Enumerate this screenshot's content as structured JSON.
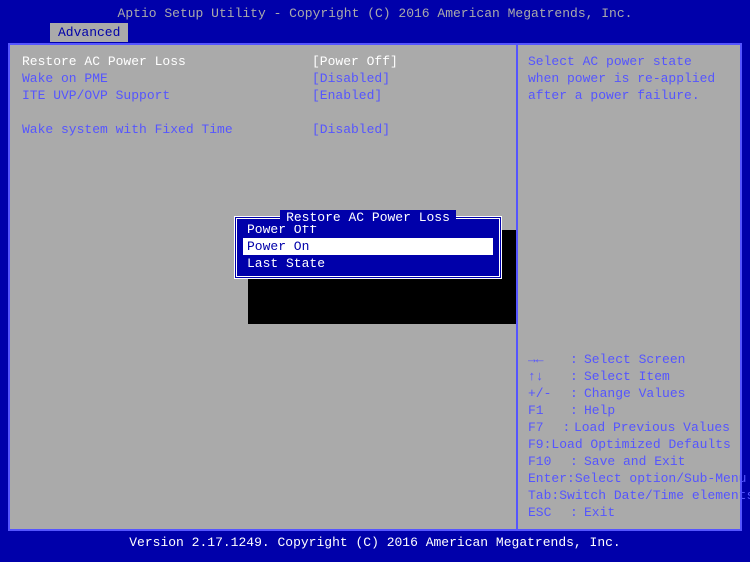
{
  "title": "Aptio Setup Utility - Copyright (C) 2016 American Megatrends, Inc.",
  "tab": "Advanced",
  "settings": [
    {
      "label": "Restore AC Power Loss",
      "value": "[Power Off]",
      "selected": true
    },
    {
      "label": "Wake on PME",
      "value": "[Disabled]",
      "selected": false
    },
    {
      "label": "ITE UVP/OVP Support",
      "value": "[Enabled]",
      "selected": false
    },
    {
      "label": "",
      "value": "",
      "blank": true
    },
    {
      "label": "Wake system with Fixed Time",
      "value": "[Disabled]",
      "selected": false
    }
  ],
  "help": "Select AC power state when power is re-applied after a power failure.",
  "keys": [
    {
      "k": "→←",
      "d": "Select Screen"
    },
    {
      "k": "↑↓",
      "d": "Select Item"
    },
    {
      "k": "+/-",
      "d": "Change Values"
    },
    {
      "k": "F1",
      "d": "Help"
    },
    {
      "k": "F7",
      "d": "Load Previous Values"
    },
    {
      "k": "F9",
      "d": "Load Optimized Defaults"
    },
    {
      "k": "F10",
      "d": "Save and Exit"
    },
    {
      "k": "Enter:",
      "d": "Select option/Sub-Menu",
      "nosep": true
    },
    {
      "k": "Tab",
      "d": "Switch Date/Time elements"
    },
    {
      "k": "ESC",
      "d": "Exit"
    }
  ],
  "popup": {
    "title": "Restore AC Power Loss",
    "options": [
      {
        "label": "Power Off",
        "selected": false
      },
      {
        "label": "Power On",
        "selected": true
      },
      {
        "label": "Last State",
        "selected": false
      }
    ]
  },
  "footer": "Version 2.17.1249. Copyright (C) 2016 American Megatrends, Inc."
}
